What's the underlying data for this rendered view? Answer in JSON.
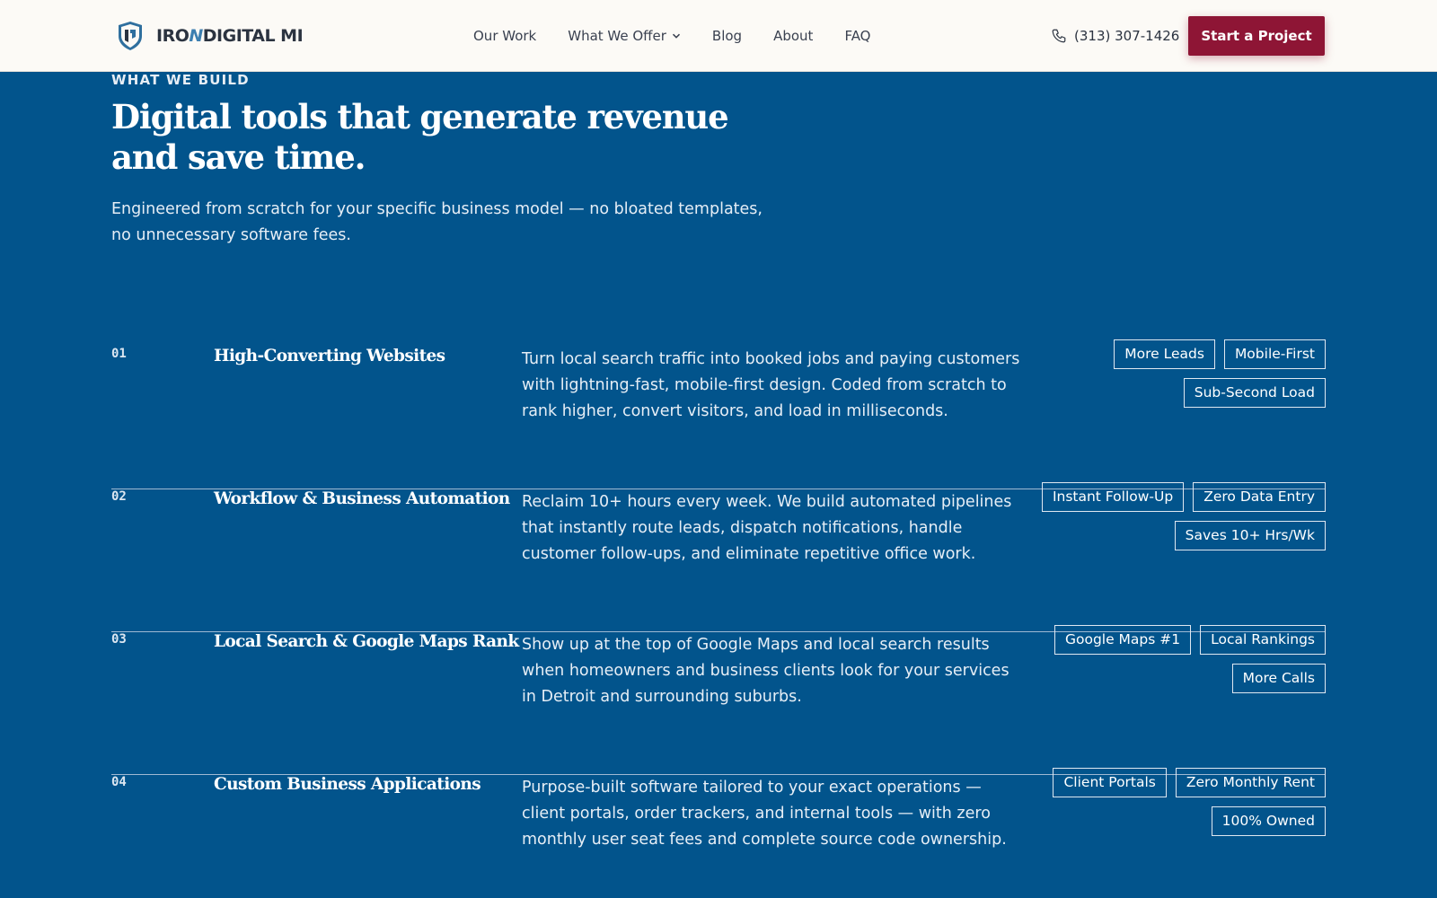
{
  "header": {
    "logo_iron": "IRO",
    "logo_n": "N",
    "logo_rest": "DIGITAL MI",
    "nav": [
      {
        "label": "Our Work"
      },
      {
        "label": "What We Offer",
        "has_dropdown": true
      },
      {
        "label": "Blog"
      },
      {
        "label": "About"
      },
      {
        "label": "FAQ"
      }
    ],
    "phone": "(313) 307-1426",
    "cta_label": "Start a Project",
    "cta_color": "#8e1535"
  },
  "intro": {
    "eyebrow": "WHAT WE BUILD",
    "title": "Digital tools that generate revenue and save time.",
    "subtitle": "Engineered from scratch for your specific business model — no bloated templates, no unnecessary software fees."
  },
  "services": [
    {
      "num": "01",
      "title": "High-Converting Websites",
      "description": "Turn local search traffic into booked jobs and paying customers with lightning-fast, mobile-first design. Coded from scratch to rank higher, convert visitors, and load in milliseconds.",
      "tags": [
        "More Leads",
        "Mobile-First",
        "Sub-Second Load"
      ]
    },
    {
      "num": "02",
      "title": "Workflow & Business Automation",
      "description": "Reclaim 10+ hours every week. We build automated pipelines that instantly route leads, dispatch notifications, handle customer follow-ups, and eliminate repetitive office work.",
      "tags": [
        "Instant Follow-Up",
        "Zero Data Entry",
        "Saves 10+ Hrs/Wk"
      ]
    },
    {
      "num": "03",
      "title": "Local Search & Google Maps Rank",
      "description": "Show up at the top of Google Maps and local search results when homeowners and business clients look for your services in Detroit and surrounding suburbs.",
      "tags": [
        "Google Maps #1",
        "Local Rankings",
        "More Calls"
      ]
    },
    {
      "num": "04",
      "title": "Custom Business Applications",
      "description": "Purpose-built software tailored to your exact operations — client portals, order trackers, and internal tools — with zero monthly user seat fees and complete source code ownership.",
      "tags": [
        "Client Portals",
        "Zero Monthly Rent",
        "100% Owned"
      ]
    }
  ],
  "colors": {
    "background": "#02548c",
    "header_bg": "#fcfaf6"
  }
}
